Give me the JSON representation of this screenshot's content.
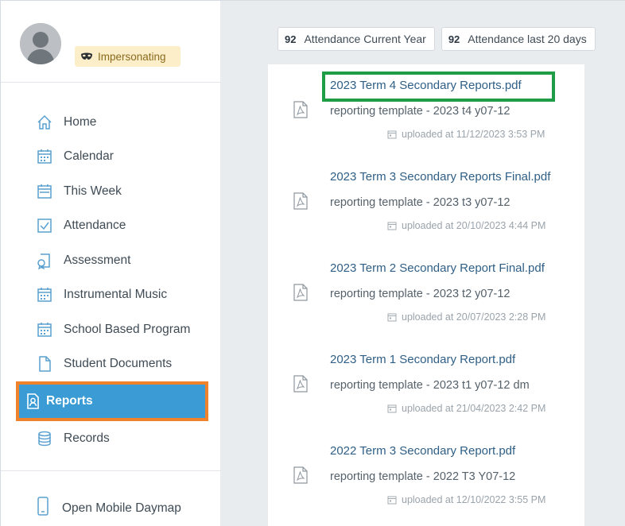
{
  "profile": {
    "badge_label": "Impersonating",
    "badge_icon": "mask-icon"
  },
  "nav": {
    "items": [
      {
        "label": "Home",
        "icon": "home-icon"
      },
      {
        "label": "Calendar",
        "icon": "calendar-icon"
      },
      {
        "label": "This Week",
        "icon": "calendar-week-icon"
      },
      {
        "label": "Attendance",
        "icon": "checkbox-icon"
      },
      {
        "label": "Assessment",
        "icon": "assessment-icon"
      },
      {
        "label": "Instrumental Music",
        "icon": "calendar-icon"
      },
      {
        "label": "School Based Program",
        "icon": "calendar-icon"
      },
      {
        "label": "Student Documents",
        "icon": "document-icon"
      },
      {
        "label": "Reports",
        "icon": "report-icon",
        "active": true
      },
      {
        "label": "Records",
        "icon": "database-icon"
      }
    ],
    "mobile_label": "Open Mobile Daymap"
  },
  "stats": [
    {
      "value": "92",
      "label": "Attendance Current Year"
    },
    {
      "value": "92",
      "label": "Attendance last 20 days"
    }
  ],
  "documents": [
    {
      "title": "2023 Term 4 Secondary Reports.pdf",
      "template": "reporting template - 2023 t4 y07-12",
      "uploaded": "uploaded at 11/12/2023 3:53 PM"
    },
    {
      "title": "2023 Term 3 Secondary Reports Final.pdf",
      "template": "reporting template - 2023 t3 y07-12",
      "uploaded": "uploaded at 20/10/2023 4:44 PM"
    },
    {
      "title": "2023 Term 2 Secondary Report Final.pdf",
      "template": "reporting template - 2023 t2 y07-12",
      "uploaded": "uploaded at 20/07/2023 2:28 PM"
    },
    {
      "title": "2023 Term 1 Secondary Report.pdf",
      "template": "reporting template - 2023 t1 y07-12 dm",
      "uploaded": "uploaded at 21/04/2023 2:42 PM"
    },
    {
      "title": "2022 Term 3 Secondary Report.pdf",
      "template": "reporting template - 2022 T3 Y07-12",
      "uploaded": "uploaded at 12/10/2022 3:55 PM"
    }
  ],
  "colors": {
    "active_nav_bg": "#3b9bd4",
    "active_nav_outline": "#f0822c",
    "highlight_outline": "#1f9c46",
    "link": "#2f5f86",
    "badge_bg": "#fbeec9"
  }
}
